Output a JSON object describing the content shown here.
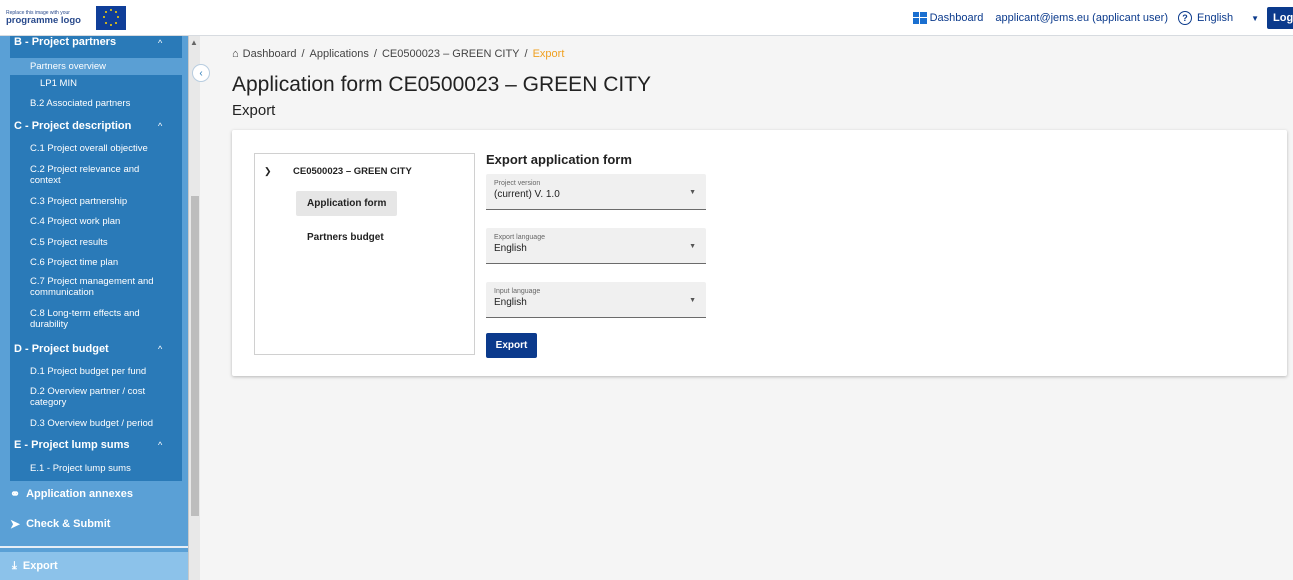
{
  "header": {
    "logo_small": "Replace this image with your",
    "logo_big": "programme logo",
    "dashboard_label": "Dashboard",
    "user_label": "applicant@jems.eu (applicant user)",
    "help_glyph": "?",
    "language_label": "English",
    "logout_label": "Logout",
    "colors": {
      "brand": "#0b3a8c",
      "eu_blue": "#0f3e99",
      "eu_star": "#ffd400"
    }
  },
  "sidebar": {
    "colors": {
      "panel": "#2a7ab8",
      "outer": "#5aa0d6",
      "export_bg": "#8cc2ea"
    },
    "section_b": {
      "label": "B - Project partners"
    },
    "partners_overview": "Partners overview",
    "lp1": "LP1 MIN",
    "b2": "B.2 Associated partners",
    "section_c": {
      "label": "C - Project description"
    },
    "c_items": [
      "C.1 Project overall objective",
      "C.2 Project relevance and",
      "context",
      "C.3 Project partnership",
      "C.4 Project work plan",
      "C.5 Project results",
      "C.6 Project time plan",
      "C.7 Project management and",
      "communication",
      "C.8 Long-term effects and",
      "durability"
    ],
    "section_d": {
      "label": "D - Project budget"
    },
    "d_items": [
      "D.1 Project budget per fund",
      "D.2 Overview partner / cost",
      "category",
      "D.3 Overview budget / period"
    ],
    "section_e": {
      "label": "E - Project lump sums"
    },
    "e_items": [
      "E.1 - Project lump sums"
    ],
    "annexes_label": "Application annexes",
    "check_submit_label": "Check & Submit",
    "export_label": "Export",
    "chevron_up": "^"
  },
  "breadcrumb": {
    "items": [
      "Dashboard",
      "Applications",
      "CE0500023 – GREEN CITY"
    ],
    "current": "Export",
    "separator": "/",
    "current_color": "#f0a020"
  },
  "page": {
    "title": "Application form CE0500023 – GREEN CITY",
    "subtitle": "Export"
  },
  "tree": {
    "root": "CE0500023 – GREEN CITY",
    "nodes": [
      "Application form",
      "Partners budget"
    ],
    "selected": "Application form"
  },
  "export_form": {
    "title": "Export application form",
    "fields": [
      {
        "label": "Project version",
        "value": "(current) V. 1.0"
      },
      {
        "label": "Export language",
        "value": "English"
      },
      {
        "label": "Input language",
        "value": "English"
      }
    ],
    "button_label": "Export"
  }
}
